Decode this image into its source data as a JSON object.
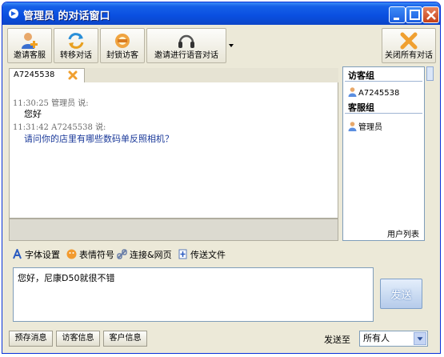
{
  "window": {
    "title": "管理员 的对话窗口"
  },
  "toolbar": {
    "buttons": [
      {
        "label": "邀请客服",
        "icon": "invite-agent-icon"
      },
      {
        "label": "转移对话",
        "icon": "transfer-icon"
      },
      {
        "label": "封锁访客",
        "icon": "block-visitor-icon"
      },
      {
        "label": "邀请进行语音对话",
        "icon": "headset-icon"
      },
      {
        "label": "关闭所有对话",
        "icon": "close-all-icon"
      }
    ]
  },
  "chat": {
    "tab_label": "A7245538",
    "messages": [
      {
        "time": "11:30:25",
        "sender": "管理员",
        "say": "说:",
        "text": "您好",
        "type": "agent"
      },
      {
        "time": "11:31:42",
        "sender": "A7245538",
        "say": "说:",
        "text": "请问你的店里有哪些数码单反照相机？",
        "type": "visitor"
      }
    ]
  },
  "userlist": {
    "visitor_group": "访客组",
    "visitors": [
      "A7245538"
    ],
    "agent_group": "客服组",
    "agents": [
      "管理员"
    ],
    "footer": "用户列表"
  },
  "format_bar": {
    "font_settings": "字体设置",
    "emoticons": "表情符号",
    "links": "连接&网页",
    "send_file": "传送文件"
  },
  "input": {
    "value": "您好，尼康D50就很不错"
  },
  "send_button": "发送",
  "bottom": {
    "buttons": [
      "预存消息",
      "访客信息",
      "客户信息"
    ],
    "send_to_label": "发送至",
    "send_to_value": "所有人"
  },
  "colors": {
    "titlebar": "#0a4fe0",
    "visitor_text": "#1b3a9a",
    "window_bg": "#ece9d8"
  }
}
